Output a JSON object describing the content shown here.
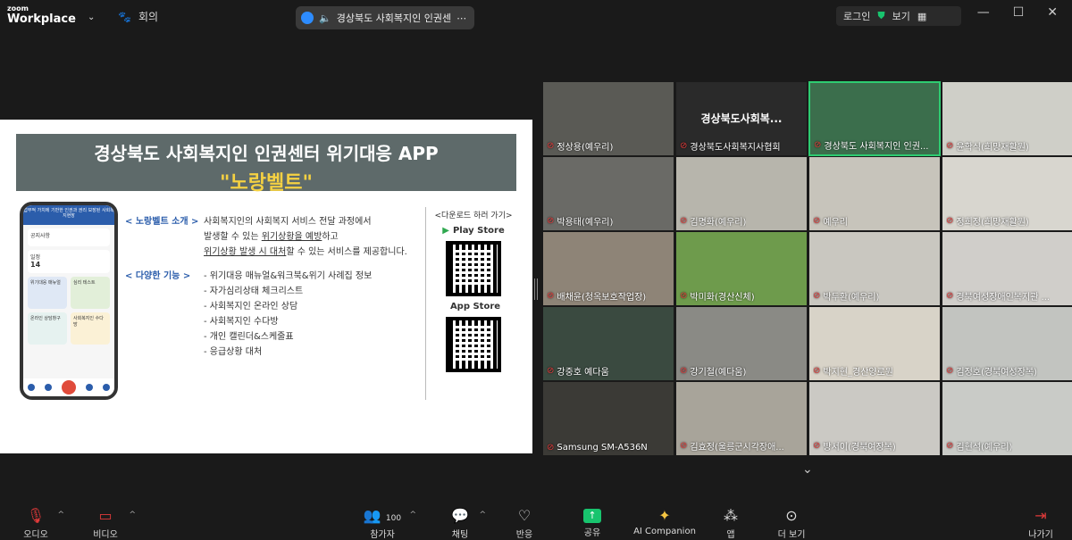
{
  "topbar": {
    "logo_line1": "zoom",
    "logo_line2": "Workplace",
    "meeting_label": "회의",
    "meeting_title": "경상북도 사회복지인 인권센",
    "login_label": "로그인",
    "view_label": "보기"
  },
  "slide": {
    "title": "경상북도 사회복지인 인권센터 위기대응 APP",
    "subtitle": "\"노랑벨트\"",
    "intro_label": "< 노랑벨트 소개 >",
    "intro_line1": "사회복지인의 사회복지 서비스 전달 과정에서",
    "intro_line2a": "발생할 수 있는 ",
    "intro_line2b": "위기상황을 예방",
    "intro_line2c": "하고",
    "intro_line3a": "위기상황 발생 시 대처",
    "intro_line3b": "할 수 있는 서비스를 제공합니다.",
    "features_label": "< 다양한 기능 >",
    "features": [
      "- 위기대응 매뉴얼&워크북&위기 사례집 정보",
      "- 자가심리상태 체크리스트",
      "- 사회복지인 온라인 상담",
      "- 사회복지인 수다방",
      "- 개인 캘린더&스케줄표",
      "- 응급상황 대처"
    ],
    "download_label": "<다운로드 하러 가기>",
    "play_store": "Play Store",
    "app_store": "App Store",
    "phone": {
      "banner": "업무적 가치에 기반한 인권과 권리 보장된 사회복지현장",
      "alert": "공지사항",
      "date_label": "일정",
      "date_num": "14",
      "cell1": "위기대응 매뉴얼",
      "cell2": "심리 테스트",
      "cell3": "온라인 상담창구",
      "cell4": "사회복지인 수다방"
    }
  },
  "participants": [
    {
      "name": "정상용(예우리)"
    },
    {
      "name": "경상북도사회복지사협회",
      "big": "경상북도사회복..."
    },
    {
      "name": "경상북도 사회복지인 인권..."
    },
    {
      "name": "윤학식(희망재활원)"
    },
    {
      "name": "박용태(예우리)"
    },
    {
      "name": "김명화(예우리)"
    },
    {
      "name": "예우리"
    },
    {
      "name": "정희정(희망재활원)"
    },
    {
      "name": "배채윤(청옥보호작업장)"
    },
    {
      "name": "박미화(경산신체)"
    },
    {
      "name": "박두환(예우리)"
    },
    {
      "name": "경북여성장애인복지관 ..."
    },
    {
      "name": "강중호 예다움"
    },
    {
      "name": "강기철(예다움)"
    },
    {
      "name": "박지현_경산양로원"
    },
    {
      "name": "김정호(경북여성장복)"
    },
    {
      "name": "Samsung SM-A536N"
    },
    {
      "name": "김효정(울릉군시각장애..."
    },
    {
      "name": "방서이(경북여장복)"
    },
    {
      "name": "김현석(예우리)"
    }
  ],
  "toolbar": {
    "audio": "오디오",
    "video": "비디오",
    "participants": "참가자",
    "participants_count": "100",
    "chat": "채팅",
    "react": "반응",
    "share": "공유",
    "ai": "AI Companion",
    "apps": "앱",
    "more": "더 보기",
    "leave": "나가기"
  }
}
